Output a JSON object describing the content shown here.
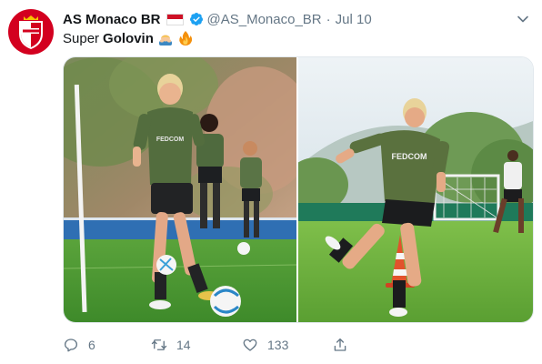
{
  "account": {
    "name": "AS Monaco BR",
    "handle": "@AS_Monaco_BR",
    "separator": "·",
    "date": "Jul 10",
    "avatar_icon": "as-monaco-crest-icon",
    "flag_icon": "monaco-flag-icon",
    "verified_icon": "verified-badge-icon"
  },
  "tweet": {
    "text_prefix": "Super",
    "text_bold": "Golovin",
    "emojis": [
      "man-bowing-emoji",
      "fire-emoji"
    ]
  },
  "media": {
    "left_photo": {
      "jersey_text": "FEDCOM"
    },
    "right_photo": {
      "jersey_text": "FEDCOM"
    }
  },
  "actions": {
    "reply_count": "6",
    "retweet_count": "14",
    "like_count": "133"
  },
  "colors": {
    "brand_red": "#d3001f",
    "verified_blue": "#1da1f2",
    "muted_gray": "#657786"
  }
}
